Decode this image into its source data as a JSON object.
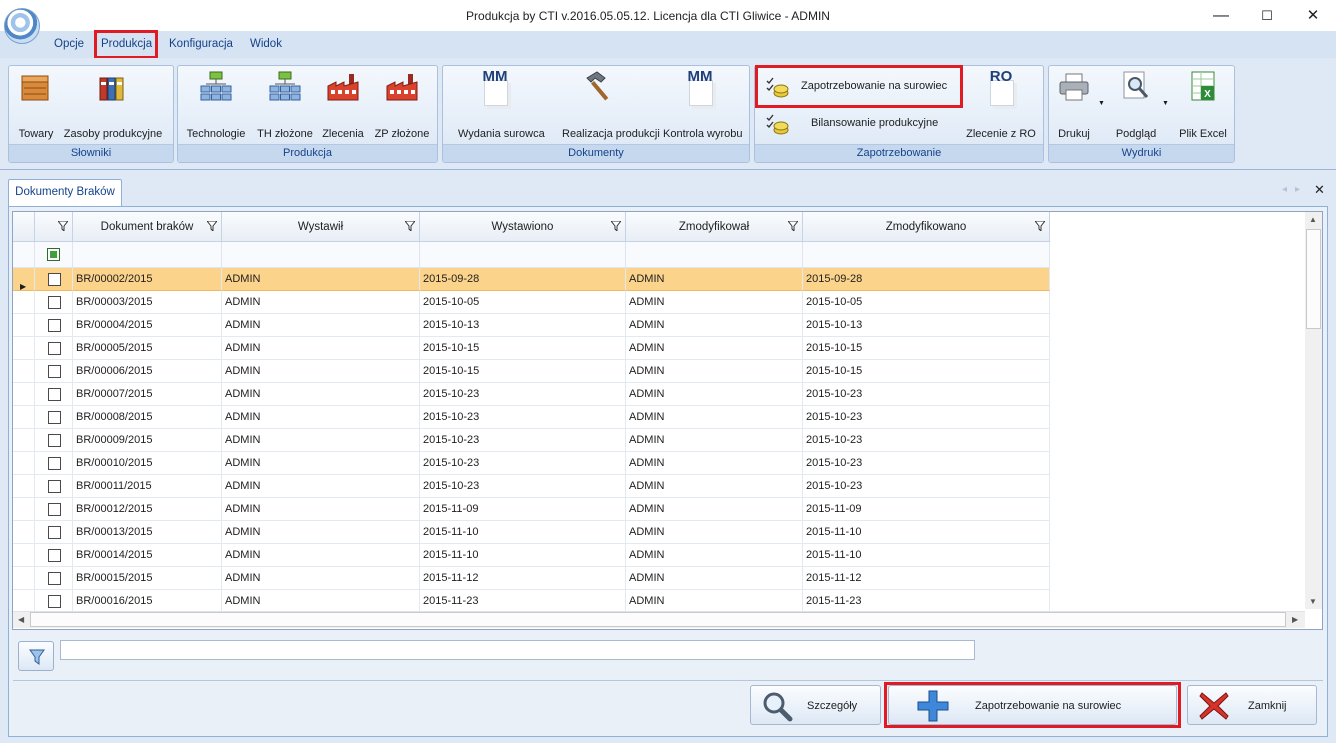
{
  "window": {
    "title": "Produkcja by CTI v.2016.05.05.12. Licencja dla CTI Gliwice - ADMIN",
    "minimize": "—",
    "maximize": "☐",
    "close": "✕"
  },
  "menu": {
    "opcje": "Opcje",
    "produkcja": "Produkcja",
    "konfiguracja": "Konfiguracja",
    "widok": "Widok"
  },
  "ribbon": {
    "groups": {
      "slowniki": "Słowniki",
      "produkcja": "Produkcja",
      "dokumenty": "Dokumenty",
      "zapotrzebowanie": "Zapotrzebowanie",
      "wydruki": "Wydruki"
    },
    "buttons": {
      "towary": "Towary",
      "zasoby": "Zasoby produkcyjne",
      "technologie": "Technologie",
      "th_zlozone": "TH złożone",
      "zlecenia": "Zlecenia",
      "zp_zlozone": "ZP złożone",
      "wydania": "Wydania surowca",
      "realizacja": "Realizacja produkcji",
      "kontrola": "Kontrola wyrobu",
      "zapotrzebowanie_surowiec": "Zapotrzebowanie na surowiec",
      "bilansowanie": "Bilansowanie produkcyjne",
      "zlecenie_ro": "Zlecenie z RO",
      "drukuj": "Drukuj",
      "podglad": "Podgląd",
      "plik_excel": "Plik Excel"
    },
    "icon_text": {
      "mm": "MM",
      "ro": "RO"
    }
  },
  "tab": {
    "title": "Dokumenty Braków",
    "nav": "◂▸",
    "close": "✕"
  },
  "grid": {
    "columns": [
      "Dokument braków",
      "Wystawił",
      "Wystawiono",
      "Zmodyfikował",
      "Zmodyfikowano"
    ],
    "selected_row": 0,
    "rows": [
      [
        "BR/00002/2015",
        "ADMIN",
        "2015-09-28",
        "ADMIN",
        "2015-09-28"
      ],
      [
        "BR/00003/2015",
        "ADMIN",
        "2015-10-05",
        "ADMIN",
        "2015-10-05"
      ],
      [
        "BR/00004/2015",
        "ADMIN",
        "2015-10-13",
        "ADMIN",
        "2015-10-13"
      ],
      [
        "BR/00005/2015",
        "ADMIN",
        "2015-10-15",
        "ADMIN",
        "2015-10-15"
      ],
      [
        "BR/00006/2015",
        "ADMIN",
        "2015-10-15",
        "ADMIN",
        "2015-10-15"
      ],
      [
        "BR/00007/2015",
        "ADMIN",
        "2015-10-23",
        "ADMIN",
        "2015-10-23"
      ],
      [
        "BR/00008/2015",
        "ADMIN",
        "2015-10-23",
        "ADMIN",
        "2015-10-23"
      ],
      [
        "BR/00009/2015",
        "ADMIN",
        "2015-10-23",
        "ADMIN",
        "2015-10-23"
      ],
      [
        "BR/00010/2015",
        "ADMIN",
        "2015-10-23",
        "ADMIN",
        "2015-10-23"
      ],
      [
        "BR/00011/2015",
        "ADMIN",
        "2015-10-23",
        "ADMIN",
        "2015-10-23"
      ],
      [
        "BR/00012/2015",
        "ADMIN",
        "2015-11-09",
        "ADMIN",
        "2015-11-09"
      ],
      [
        "BR/00013/2015",
        "ADMIN",
        "2015-11-10",
        "ADMIN",
        "2015-11-10"
      ],
      [
        "BR/00014/2015",
        "ADMIN",
        "2015-11-10",
        "ADMIN",
        "2015-11-10"
      ],
      [
        "BR/00015/2015",
        "ADMIN",
        "2015-11-12",
        "ADMIN",
        "2015-11-12"
      ],
      [
        "BR/00016/2015",
        "ADMIN",
        "2015-11-23",
        "ADMIN",
        "2015-11-23"
      ]
    ]
  },
  "filter": {
    "value": ""
  },
  "buttons": {
    "szczegoly": "Szczegóły",
    "zapotrzebowanie": "Zapotrzebowanie na surowiec",
    "zamknij": "Zamknij"
  },
  "colors": {
    "accent": "#15428b",
    "highlight": "#e01b24",
    "selected_row": "#fbd38b"
  }
}
